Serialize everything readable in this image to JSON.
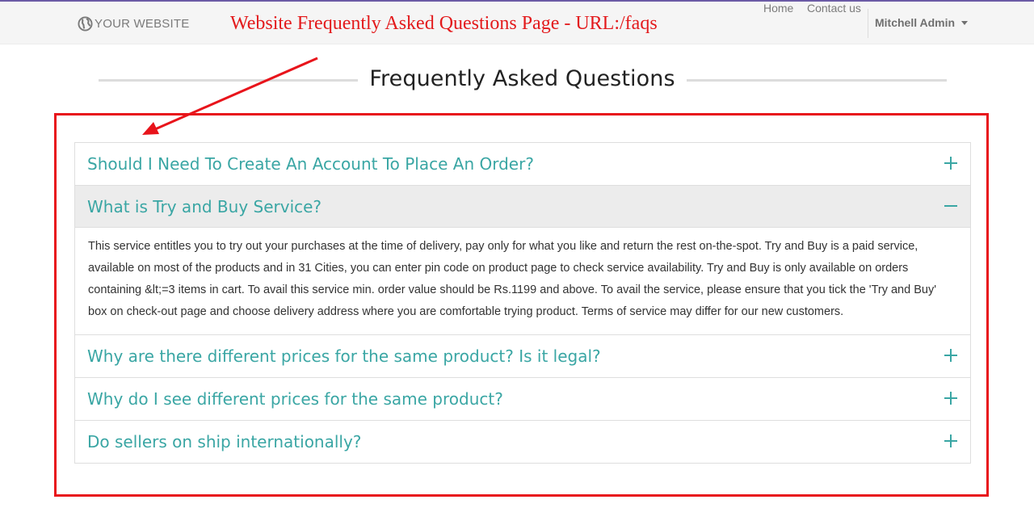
{
  "navbar": {
    "brand": "YOUR WEBSITE",
    "brand_icon": "globe-icon",
    "links": {
      "home": "Home",
      "contact": "Contact us"
    },
    "user": "Mitchell Admin"
  },
  "annotation": "Website Frequently Asked Questions Page - URL:/faqs",
  "page": {
    "title": "Frequently Asked Questions"
  },
  "faq": {
    "items": [
      {
        "question": "Should I Need To Create An Account To Place An Order?",
        "state": "collapsed",
        "icon": "plus-icon"
      },
      {
        "question": "What is Try and Buy Service?",
        "state": "expanded",
        "icon": "minus-icon",
        "answer": "This service entitles you to try out your purchases at the time of delivery, pay only for what you like and return the rest on-the-spot. Try and Buy is a paid service, available on most of the products and in 31 Cities, you can enter pin code on product page to check service availability. Try and Buy is only available on orders containing &lt;=3 items in cart. To avail this service min. order value should be Rs.1199 and above. To avail the service, please ensure that you tick the 'Try and Buy' box on check-out page and choose delivery address where you are comfortable trying product. Terms of service may differ for our new customers."
      },
      {
        "question": "Why are there different prices for the same product? Is it legal?",
        "state": "collapsed",
        "icon": "plus-icon"
      },
      {
        "question": "Why do I see different prices for the same product?",
        "state": "collapsed",
        "icon": "plus-icon"
      },
      {
        "question": "Do sellers on ship internationally?",
        "state": "collapsed",
        "icon": "plus-icon"
      }
    ]
  },
  "colors": {
    "accent": "#3aa6a4",
    "annotation_red": "#e31a1c",
    "navbar_bg": "#f5f5f5",
    "expanded_header_bg": "#ececec"
  }
}
